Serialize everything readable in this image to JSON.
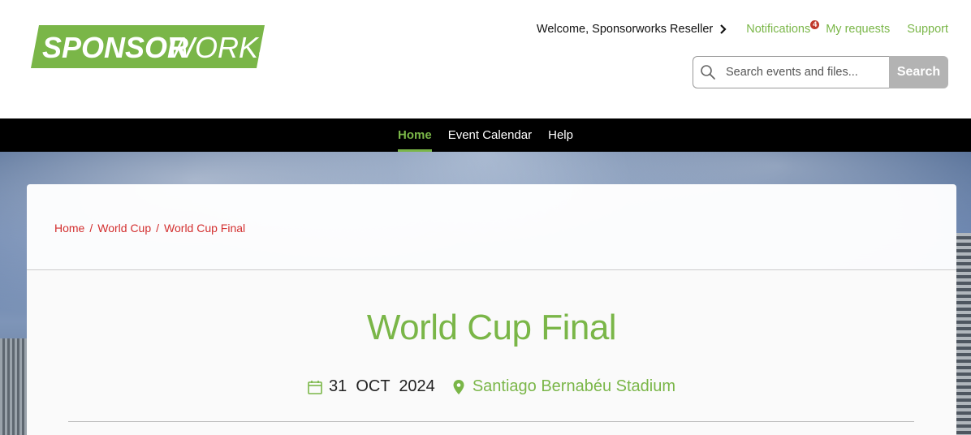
{
  "brand": {
    "logo_text_bold": "SPONSOR",
    "logo_text_light": "WORKS",
    "logo_color": "#7ab648"
  },
  "topnav": {
    "welcome": "Welcome, Sponsorworks Reseller",
    "notifications": "Notifications",
    "notification_count": "4",
    "my_requests": "My requests",
    "support": "Support"
  },
  "search": {
    "placeholder": "Search events and files...",
    "button": "Search"
  },
  "mainnav": {
    "items": [
      {
        "label": "Home",
        "active": true
      },
      {
        "label": "Event Calendar",
        "active": false
      },
      {
        "label": "Help",
        "active": false
      }
    ]
  },
  "breadcrumb": {
    "items": [
      "Home",
      "World Cup",
      "World Cup Final"
    ],
    "separator": "/"
  },
  "event": {
    "title": "World Cup Final",
    "date": "31  OCT  2024",
    "location": "Santiago Bernabéu Stadium"
  },
  "colors": {
    "accent": "#7ab648",
    "link_red": "#d32f2f",
    "nav_bg": "#000000",
    "badge": "#c0392b"
  },
  "icons": {
    "welcome_chevron": "chevron-right-icon",
    "search": "search-icon",
    "date": "calendar-icon",
    "location": "map-pin-icon"
  }
}
